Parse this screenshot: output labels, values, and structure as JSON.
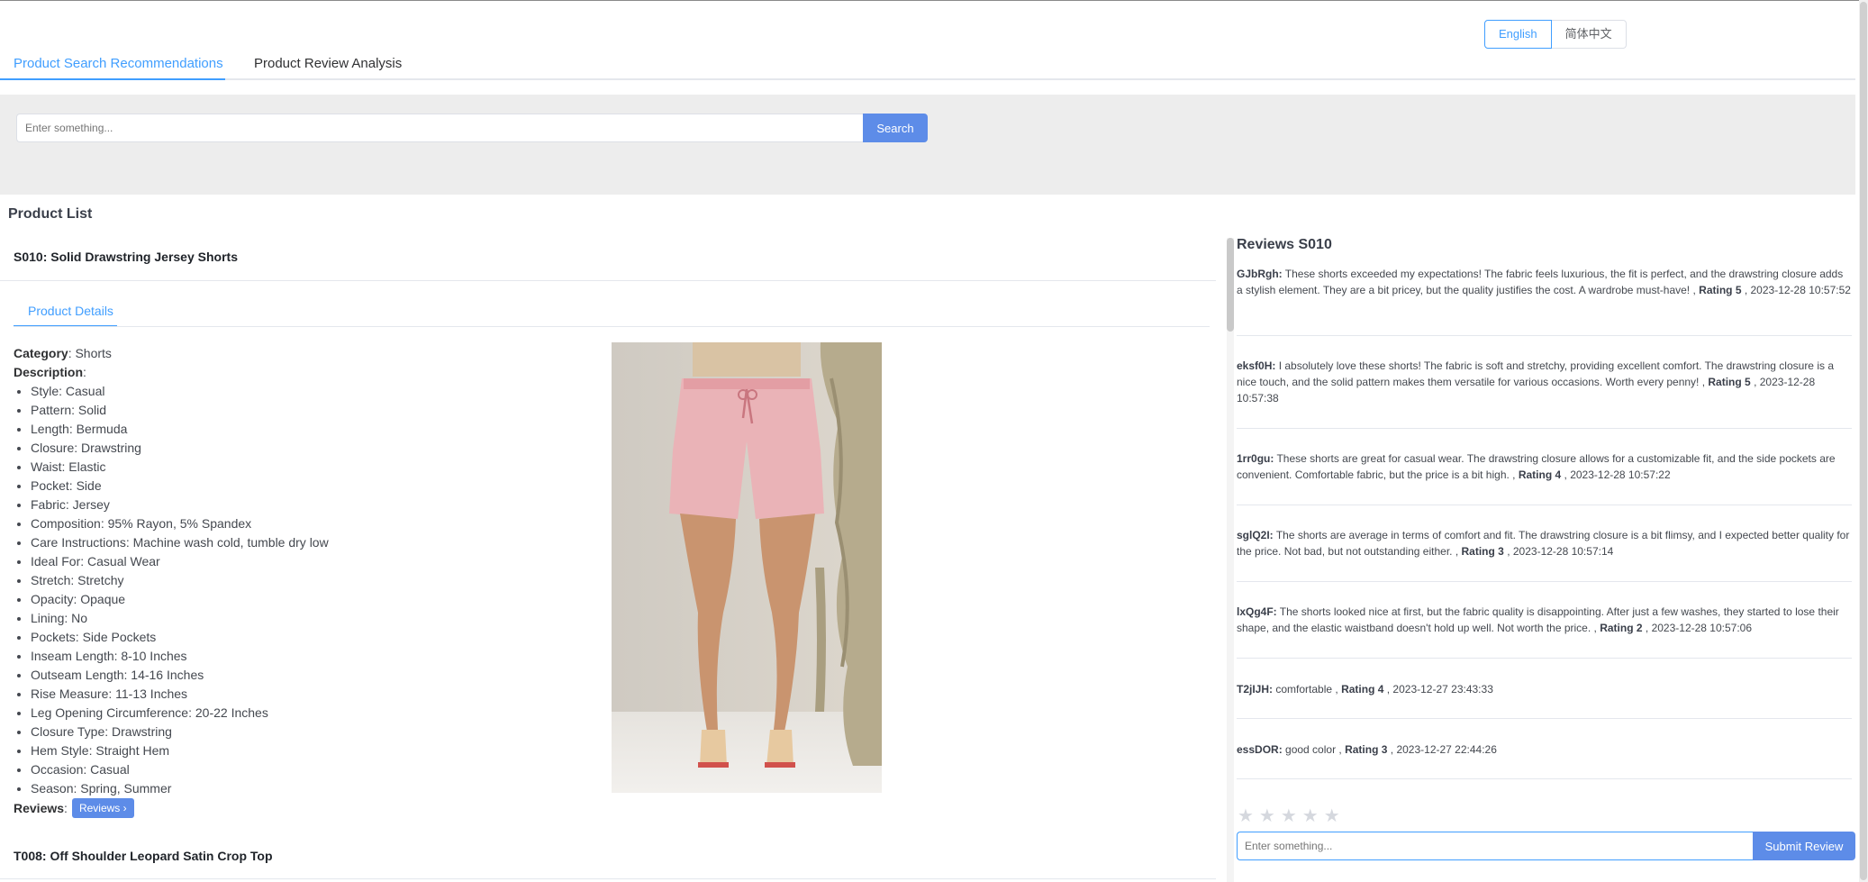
{
  "language": {
    "english": "English",
    "chinese": "简体中文"
  },
  "tabs": {
    "search": "Product Search Recommendations",
    "review": "Product Review Analysis"
  },
  "search": {
    "placeholder": "Enter something...",
    "button": "Search"
  },
  "list_title": "Product List",
  "product": {
    "name": "S010: Solid Drawstring Jersey Shorts",
    "details_tab": "Product Details",
    "category_label": "Category",
    "category": "Shorts",
    "description_label": "Description",
    "description": [
      "Style: Casual",
      "Pattern: Solid",
      "Length: Bermuda",
      "Closure: Drawstring",
      "Waist: Elastic",
      "Pocket: Side",
      "Fabric: Jersey",
      "Composition: 95% Rayon, 5% Spandex",
      "Care Instructions: Machine wash cold, tumble dry low",
      "Ideal For: Casual Wear",
      "Stretch: Stretchy",
      "Opacity: Opaque",
      "Lining: No",
      "Pockets: Side Pockets",
      "Inseam Length: 8-10 Inches",
      "Outseam Length: 14-16 Inches",
      "Rise Measure: 11-13 Inches",
      "Leg Opening Circumference: 20-22 Inches",
      "Closure Type: Drawstring",
      "Hem Style: Straight Hem",
      "Occasion: Casual",
      "Season: Spring, Summer"
    ],
    "reviews_label": "Reviews",
    "reviews_button": "Reviews"
  },
  "next_product": {
    "name": "T008: Off Shoulder Leopard Satin Crop Top"
  },
  "reviews": {
    "title": "Reviews S010",
    "items": [
      {
        "user": "GJbRgh:",
        "text": "These shorts exceeded my expectations! The fabric feels luxurious, the fit is perfect, and the drawstring closure adds a stylish element. They are a bit pricey, but the quality justifies the cost. A wardrobe must-have! ,",
        "rating": "Rating 5",
        "date": ", 2023-12-28 10:57:52"
      },
      {
        "user": "eksf0H:",
        "text": "I absolutely love these shorts! The fabric is soft and stretchy, providing excellent comfort. The drawstring closure is a nice touch, and the solid pattern makes them versatile for various occasions. Worth every penny! ,",
        "rating": "Rating 5",
        "date": ", 2023-12-28 10:57:38"
      },
      {
        "user": "1rr0gu:",
        "text": "These shorts are great for casual wear. The drawstring closure allows for a customizable fit, and the side pockets are convenient. Comfortable fabric, but the price is a bit high. ,",
        "rating": "Rating 4",
        "date": ", 2023-12-28 10:57:22"
      },
      {
        "user": "sglQ2I:",
        "text": "The shorts are average in terms of comfort and fit. The drawstring closure is a bit flimsy, and I expected better quality for the price. Not bad, but not outstanding either. ,",
        "rating": "Rating 3",
        "date": ", 2023-12-28 10:57:14"
      },
      {
        "user": "lxQg4F:",
        "text": "The shorts looked nice at first, but the fabric quality is disappointing. After just a few washes, they started to lose their shape, and the elastic waistband doesn't hold up well. Not worth the price. ,",
        "rating": "Rating 2",
        "date": ", 2023-12-28 10:57:06"
      },
      {
        "user": "T2jIJH:",
        "text": "comfortable ,",
        "rating": "Rating 4",
        "date": ", 2023-12-27 23:43:33"
      },
      {
        "user": "essDOR:",
        "text": "good color ,",
        "rating": "Rating 3",
        "date": ", 2023-12-27 22:44:26"
      }
    ],
    "stars": "★★★★★",
    "input_placeholder": "Enter something...",
    "submit": "Submit Review"
  },
  "colors": {
    "accent": "#409eff",
    "button": "#5d8ce8",
    "band": "#ededed"
  }
}
